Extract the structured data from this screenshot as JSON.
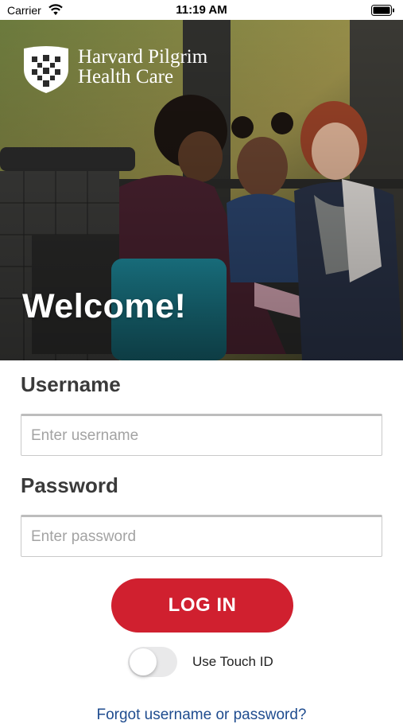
{
  "status_bar": {
    "carrier": "Carrier",
    "time": "11:19 AM"
  },
  "brand": {
    "line1": "Harvard Pilgrim",
    "line2": "Health Care"
  },
  "hero": {
    "welcome": "Welcome!"
  },
  "form": {
    "username_label": "Username",
    "username_placeholder": "Enter username",
    "password_label": "Password",
    "password_placeholder": "Enter password",
    "login_label": "LOG IN",
    "touch_id_label": "Use Touch ID",
    "touch_id_enabled": false,
    "forgot_text": "Forgot username or password?"
  },
  "colors": {
    "accent": "#d0202f",
    "link": "#1f4c8f"
  }
}
